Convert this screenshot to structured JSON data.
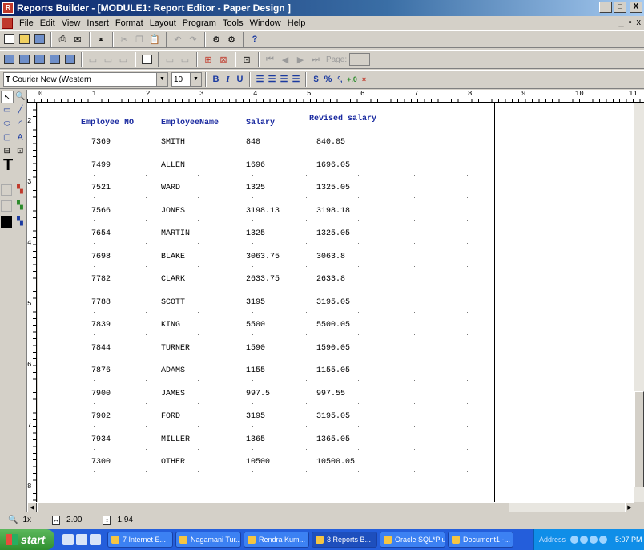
{
  "window": {
    "title": "Reports Builder - [MODULE1: Report Editor - Paper Design ]",
    "buttons": {
      "minimize": "_",
      "maximize": "□",
      "close": "X"
    }
  },
  "menu": {
    "items": [
      "File",
      "Edit",
      "View",
      "Insert",
      "Format",
      "Layout",
      "Program",
      "Tools",
      "Window",
      "Help"
    ],
    "mdi_buttons": {
      "minimize": "_",
      "restore": "▫",
      "close": "x"
    }
  },
  "toolbar_nav": {
    "page_label": "Page:"
  },
  "format_toolbar": {
    "font_value": "Courier New (Western",
    "size_value": "10",
    "bold": "B",
    "italic": "I",
    "underline": "U",
    "currency": "$",
    "percent": "%"
  },
  "ruler": {
    "h_numbers": [
      "0",
      "1",
      "2",
      "3",
      "4",
      "5",
      "6",
      "7",
      "8",
      "9",
      "10",
      "11"
    ],
    "v_numbers": [
      "2",
      "3",
      "4",
      "5",
      "6",
      "7",
      "8"
    ]
  },
  "report": {
    "headers": {
      "empno": "Employee NO",
      "ename": "EmployeeName",
      "salary": "Salary",
      "revised": "Revised salary"
    },
    "rows": [
      {
        "empno": "7369",
        "ename": "SMITH",
        "salary": "840",
        "revised": "840.05"
      },
      {
        "empno": "7499",
        "ename": "ALLEN",
        "salary": "1696",
        "revised": "1696.05"
      },
      {
        "empno": "7521",
        "ename": "WARD",
        "salary": "1325",
        "revised": "1325.05"
      },
      {
        "empno": "7566",
        "ename": "JONES",
        "salary": "3198.13",
        "revised": "3198.18"
      },
      {
        "empno": "7654",
        "ename": "MARTIN",
        "salary": "1325",
        "revised": "1325.05"
      },
      {
        "empno": "7698",
        "ename": "BLAKE",
        "salary": "3063.75",
        "revised": "3063.8"
      },
      {
        "empno": "7782",
        "ename": "CLARK",
        "salary": "2633.75",
        "revised": "2633.8"
      },
      {
        "empno": "7788",
        "ename": "SCOTT",
        "salary": "3195",
        "revised": "3195.05"
      },
      {
        "empno": "7839",
        "ename": "KING",
        "salary": "5500",
        "revised": "5500.05"
      },
      {
        "empno": "7844",
        "ename": "TURNER",
        "salary": "1590",
        "revised": "1590.05"
      },
      {
        "empno": "7876",
        "ename": "ADAMS",
        "salary": "1155",
        "revised": "1155.05"
      },
      {
        "empno": "7900",
        "ename": "JAMES",
        "salary": "997.5",
        "revised": "997.55"
      },
      {
        "empno": "7902",
        "ename": "FORD",
        "salary": "3195",
        "revised": "3195.05"
      },
      {
        "empno": "7934",
        "ename": "MILLER",
        "salary": "1365",
        "revised": "1365.05"
      },
      {
        "empno": "7300",
        "ename": "OTHER",
        "salary": "10500",
        "revised": "10500.05"
      }
    ]
  },
  "status": {
    "zoom": "1x",
    "x_pos": "2.00",
    "y_pos": "1.94"
  },
  "taskbar": {
    "start": "start",
    "tasks": [
      "7 Internet E...",
      "Nagamani Tur...",
      "Rendra Kum...",
      "3 Reports B...",
      "Oracle SQL*Plus",
      "Document1 -..."
    ],
    "address_label": "Address",
    "clock": "5:07 PM"
  }
}
